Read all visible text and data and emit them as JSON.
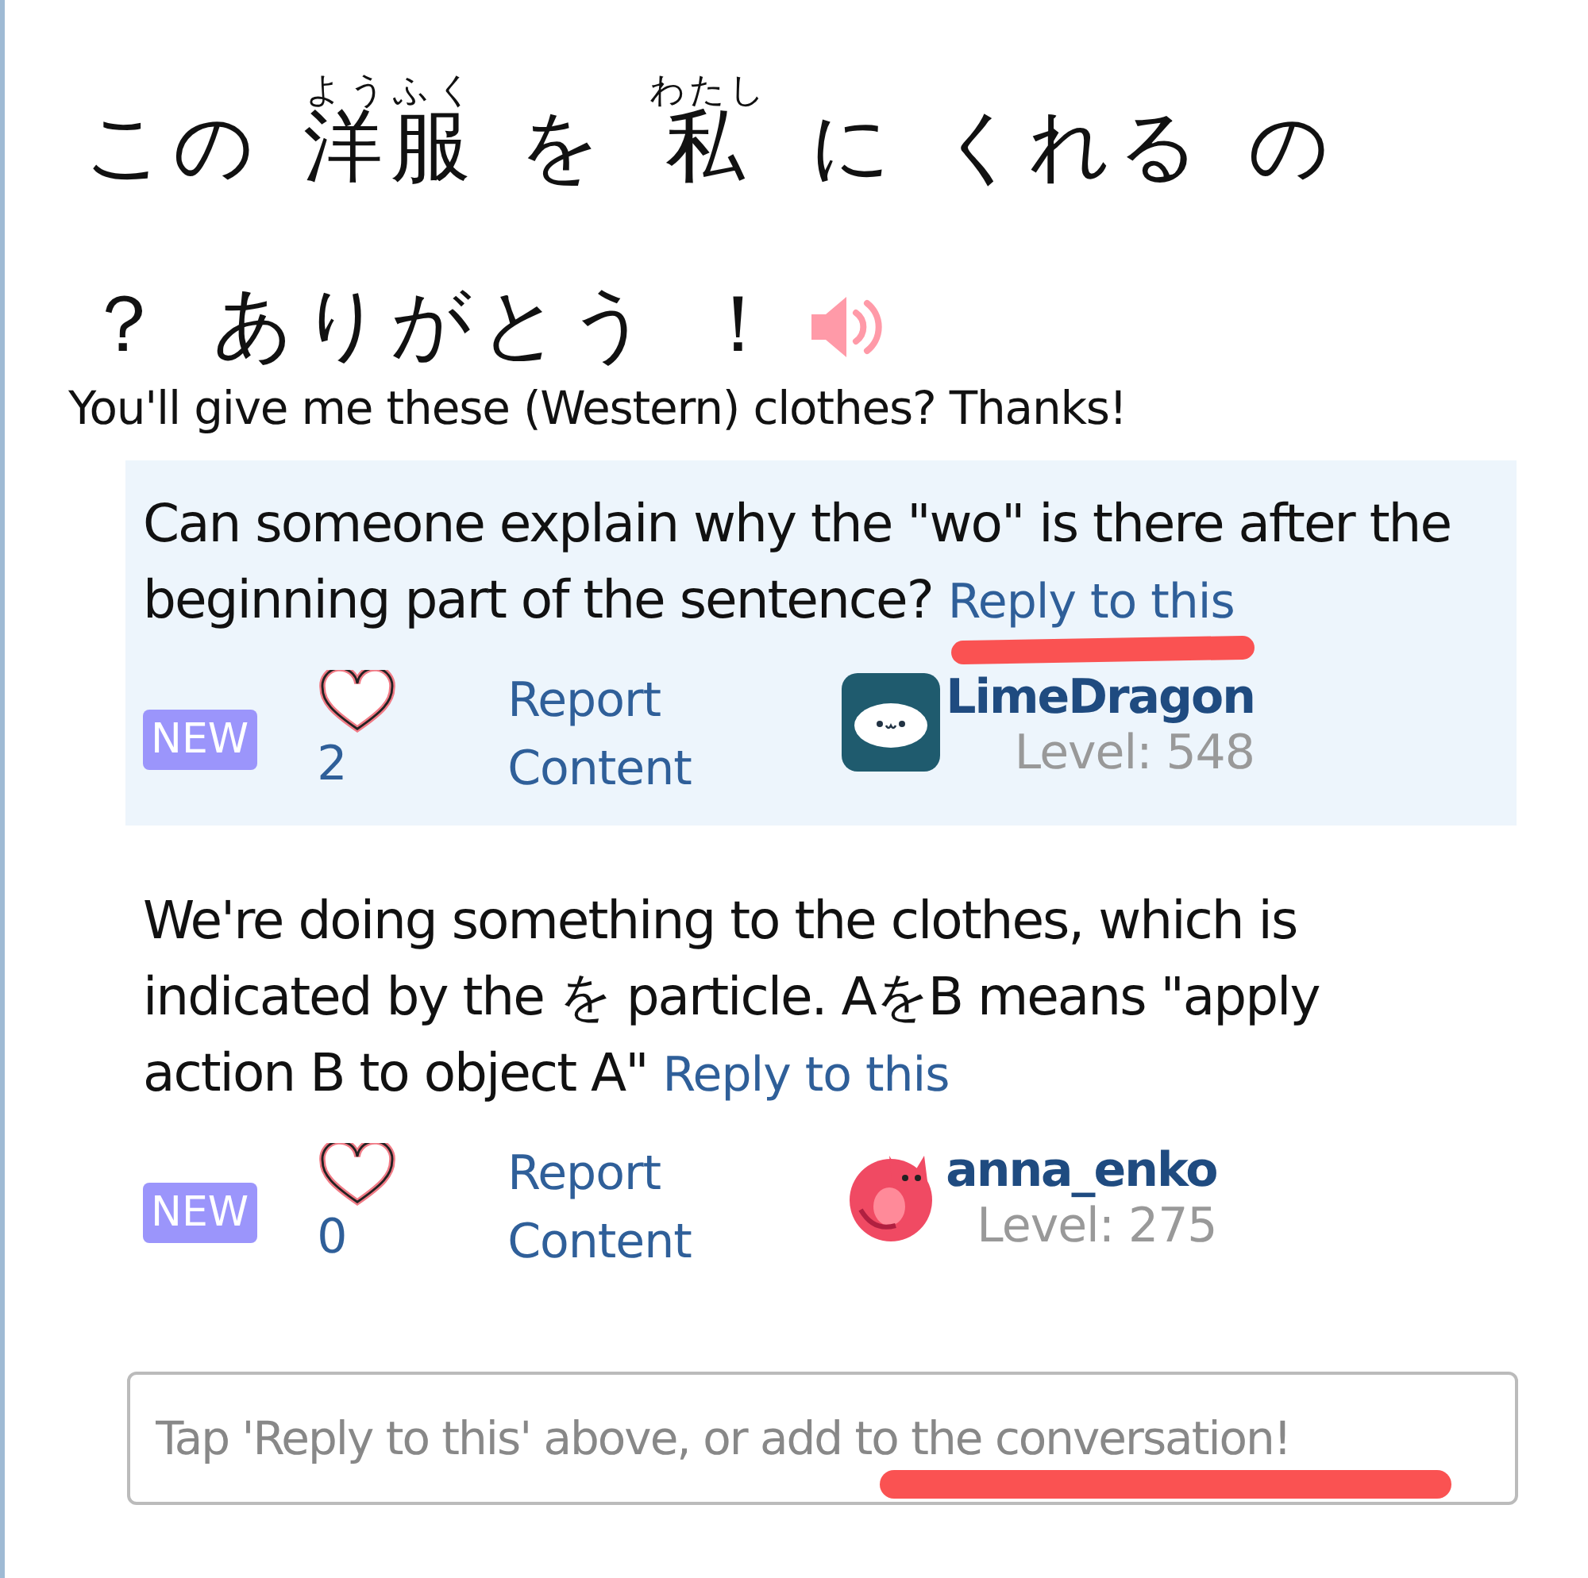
{
  "sentence_lines": [
    [
      {
        "text": "この"
      },
      {
        "text": "洋服",
        "reading": "ようふく"
      },
      {
        "text": "を"
      },
      {
        "text": "私",
        "reading": "わたし"
      },
      {
        "text": "に"
      },
      {
        "text": "くれる"
      },
      {
        "text": "の"
      }
    ],
    [
      {
        "text": "？"
      },
      {
        "text": "ありがとう"
      },
      {
        "text": "！"
      }
    ]
  ],
  "translation": "You'll give me these (Western) clothes? Thanks!",
  "comments": [
    {
      "text": "Can someone explain why the \"wo\" is there after the beginning part of the sentence?",
      "reply_link": "Reply to this",
      "highlighted": true,
      "marked": true,
      "badge": "NEW",
      "likes": "2",
      "report": "Report Content",
      "user": "LimeDragon",
      "level": "Level: 548"
    },
    {
      "text": "We're doing something to the clothes, which is indicated by the を particle. AをB means \"apply action B to object A\"",
      "reply_link": "Reply to this",
      "highlighted": false,
      "marked": false,
      "badge": "NEW",
      "likes": "0",
      "report": "Report Content",
      "user": "anna_enko",
      "level": "Level: 275"
    }
  ],
  "reply_field": {
    "placeholder": "Tap 'Reply to this' above, or add to the conversation!",
    "marked": true
  }
}
